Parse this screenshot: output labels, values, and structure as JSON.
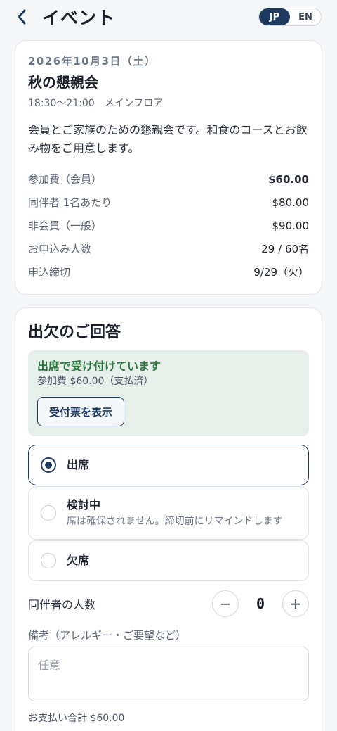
{
  "header": {
    "title": "イベント",
    "lang_options": [
      "JP",
      "EN"
    ],
    "lang_selected": "JP"
  },
  "event": {
    "date": "2026年10月3日（土）",
    "name": "秋の懇親会",
    "time": "18:30〜21:00",
    "location": "メインフロア",
    "description": "会員とご家族のための懇親会です。和食のコースとお飲み物をご用意します。",
    "info": [
      {
        "label": "参加費（会員）",
        "value": "$60.00"
      },
      {
        "label": "同伴者 1名あたり",
        "value": "$80.00"
      },
      {
        "label": "非会員（一般）",
        "value": "$90.00"
      },
      {
        "label": "お申込み人数",
        "value": "29 / 60名"
      },
      {
        "label": "申込締切",
        "value": "9/29（火）"
      }
    ]
  },
  "rsvp": {
    "title": "出欠のご回答",
    "status_title": "出席で受け付けています",
    "status_sub": "参加費 $60.00（支払済）",
    "ticket_button": "受付票を表示",
    "options": [
      {
        "label": "出席",
        "desc": "",
        "selected": true
      },
      {
        "label": "検討中",
        "desc": "席は確保されません。締切前にリマインドします",
        "selected": false
      },
      {
        "label": "欠席",
        "desc": "",
        "selected": false
      }
    ],
    "companion_label": "同伴者の人数",
    "companion_count": "0",
    "minus_symbol": "−",
    "plus_symbol": "+",
    "notes_label": "備考（アレルギー・ご要望など）",
    "notes_placeholder": "任意",
    "notes_value": "",
    "total": "お支払い合計 $60.00"
  },
  "colors": {
    "accent": "#1e3a5f",
    "success": "#2d7a3e",
    "success_bg": "#e6efe9"
  },
  "icons": {
    "back": "chevron-left-icon"
  }
}
